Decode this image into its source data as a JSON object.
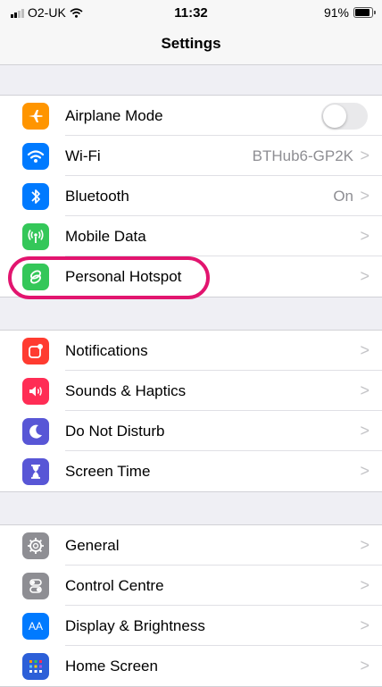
{
  "status_bar": {
    "carrier": "O2-UK",
    "time": "11:32",
    "battery": "91%",
    "battery_level": 0.91
  },
  "nav": {
    "title": "Settings"
  },
  "groups": [
    {
      "rows": [
        {
          "label": "Airplane Mode",
          "icon": "airplane-icon",
          "color": "#ff9500",
          "control": "toggle",
          "toggle_on": false
        },
        {
          "label": "Wi-Fi",
          "icon": "wifi-icon",
          "color": "#007aff",
          "value": "BTHub6-GP2K"
        },
        {
          "label": "Bluetooth",
          "icon": "bluetooth-icon",
          "color": "#007aff",
          "value": "On"
        },
        {
          "label": "Mobile Data",
          "icon": "antenna-icon",
          "color": "#34c759"
        },
        {
          "label": "Personal Hotspot",
          "icon": "hotspot-chain-icon",
          "color": "#34c759",
          "highlighted": true,
          "highlight_color": "#e2156f"
        }
      ]
    },
    {
      "rows": [
        {
          "label": "Notifications",
          "icon": "notifications-icon",
          "color": "#ff3b30"
        },
        {
          "label": "Sounds & Haptics",
          "icon": "speaker-icon",
          "color": "#ff2d55"
        },
        {
          "label": "Do Not Disturb",
          "icon": "moon-icon",
          "color": "#5856d6"
        },
        {
          "label": "Screen Time",
          "icon": "hourglass-icon",
          "color": "#5856d6"
        }
      ]
    },
    {
      "rows": [
        {
          "label": "General",
          "icon": "gear-icon",
          "color": "#8e8e93"
        },
        {
          "label": "Control Centre",
          "icon": "switches-icon",
          "color": "#8e8e93"
        },
        {
          "label": "Display & Brightness",
          "icon": "text-size-icon",
          "color": "#007aff",
          "glyph": "AA"
        },
        {
          "label": "Home Screen",
          "icon": "home-screen-grid-icon",
          "color": "#2c5fd8"
        }
      ]
    }
  ]
}
